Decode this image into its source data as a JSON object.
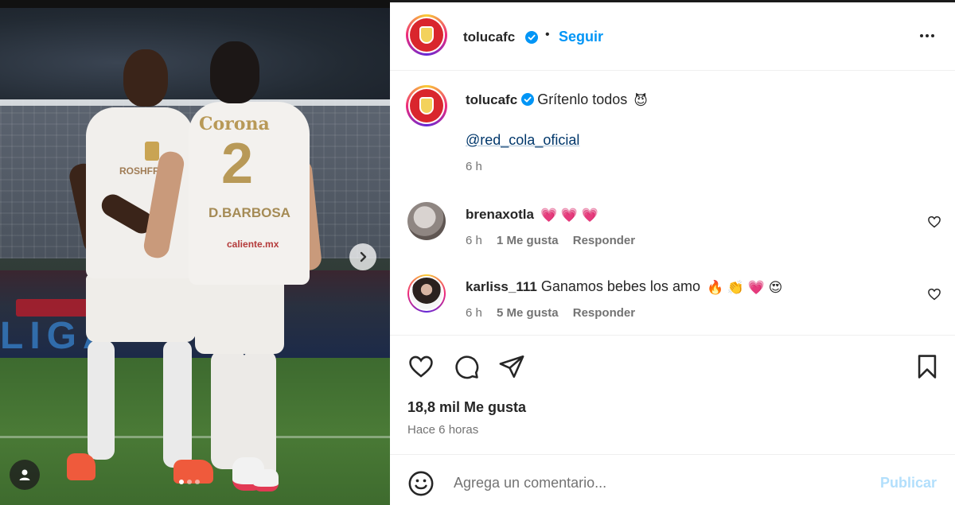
{
  "media": {
    "jersey_brand": "Corona",
    "jersey_number": "2",
    "jersey_name": "D.BARBOSA",
    "jersey_sponsor": "caliente.mx",
    "chest_sponsor": "ROSHFR",
    "board_text": "LIGA",
    "carousel_dots": 3,
    "carousel_index": 1
  },
  "header": {
    "username": "tolucafc",
    "separator": "•",
    "follow_label": "Seguir"
  },
  "caption": {
    "username": "tolucafc",
    "text": "Grítenlo todos",
    "emoji": "😈",
    "mention": "@red_cola_oficial",
    "time": "6 h"
  },
  "comments": [
    {
      "username": "brenaxotla",
      "text": "",
      "emojis": "💗 💗 💗",
      "time": "6 h",
      "likes": "1 Me gusta",
      "reply": "Responder"
    },
    {
      "username": "karliss_111",
      "text": "Ganamos bebes los amo",
      "emojis": "🔥 👏 💗 😍",
      "time": "6 h",
      "likes": "5 Me gusta",
      "reply": "Responder"
    }
  ],
  "stats": {
    "likes": "18,8 mil Me gusta",
    "when": "Hace 6 horas"
  },
  "composer": {
    "placeholder": "Agrega un comentario...",
    "publish_label": "Publicar"
  },
  "colors": {
    "accent": "#0095f6",
    "publish_disabled": "#b2dffc",
    "verified": "#0095f6",
    "brand_red": "#d9262d"
  },
  "icons": {
    "verified": "verified-badge-icon",
    "more": "more-options-icon",
    "like": "heart-icon",
    "comment": "comment-bubble-icon",
    "share": "paper-plane-icon",
    "save": "bookmark-icon",
    "emoji": "emoji-smile-icon",
    "next": "chevron-right-icon",
    "tags": "user-tag-icon"
  }
}
